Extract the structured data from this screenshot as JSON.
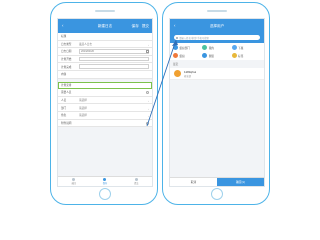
{
  "left_phone": {
    "header": {
      "back_icon": "arrow-left-icon",
      "title": "新建日志",
      "action_1": "保存",
      "action_2": "提交"
    },
    "rows": [
      {
        "label": "标题",
        "value": ""
      },
      {
        "label": "日志类型",
        "value": "发起人日志"
      },
      {
        "label": "日志日期",
        "value": "2019/03/20"
      },
      {
        "label": "计划开始",
        "value": ""
      },
      {
        "label": "计划完成",
        "value": ""
      },
      {
        "label": "内容",
        "value": ""
      },
      {
        "label": "计划安排",
        "value": ""
      },
      {
        "label": "需要人员",
        "value": ""
      },
      {
        "label": "人员",
        "value": "请选择"
      },
      {
        "label": "部门",
        "value": "请选择"
      },
      {
        "label": "角色",
        "value": "请选择"
      },
      {
        "label": "附件说明",
        "value": ""
      }
    ],
    "tabs": [
      "返回",
      "保存",
      "提交"
    ]
  },
  "right_phone": {
    "header": {
      "back_icon": "arrow-left-icon",
      "title": "选择用户"
    },
    "search_placeholder": "请输入姓名/拼音/手机号搜索",
    "quick": [
      "组织部门",
      "我的",
      "下属",
      "组织",
      "群组",
      "标签"
    ],
    "section_title": "最近",
    "contact": {
      "name": "1183qhui",
      "sub": "研发部"
    },
    "buttons": {
      "cancel": "取消",
      "confirm": "确定(1)"
    }
  },
  "colors": {
    "accent": "#3a95e0",
    "phone_frame": "#4db3e8",
    "highlight": "#7cc24a",
    "avatar": "#f0a030"
  }
}
